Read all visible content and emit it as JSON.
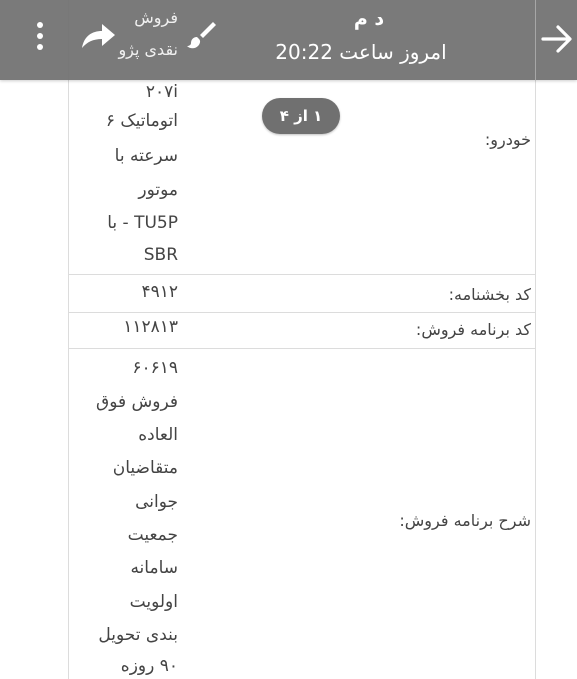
{
  "toolbar": {
    "title": "د م",
    "subtitle": "امروز ساعت 20:22",
    "doc_peek": [
      "فروش",
      "نقدی پژو"
    ]
  },
  "pager": {
    "label": "۱ از ۴"
  },
  "details": {
    "car": {
      "label": "خودرو:",
      "value_lines": [
        "۲۰۷i",
        "اتوماتیک ۶",
        "سرعته با",
        "موتور",
        "TU5P - با",
        "SBR"
      ]
    },
    "circular_code": {
      "label": "کد بخشنامه:",
      "value": "۴۹۱۲"
    },
    "program_code": {
      "label": "کد برنامه فروش:",
      "value": "۱۱۲۸۱۳"
    },
    "program_desc": {
      "label": "شرح برنامه فروش:",
      "value_lines": [
        "۶۰۶۱۹",
        "فروش فوق",
        "العاده",
        "متقاضیان",
        "جوانی",
        "جمعیت",
        "سامانه",
        "اولویت",
        "بندی تحویل",
        "۹۰ روزه"
      ]
    }
  }
}
